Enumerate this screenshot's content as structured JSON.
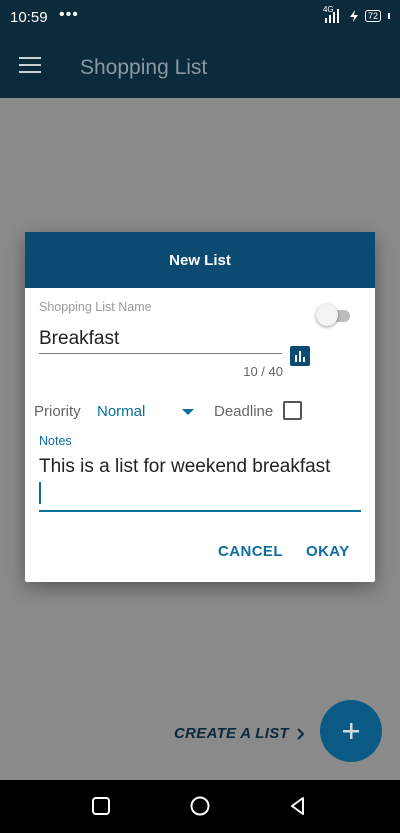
{
  "status_bar": {
    "time": "10:59",
    "dots": "•••",
    "network": "4G",
    "battery": "72"
  },
  "app_bar": {
    "title": "Shopping List"
  },
  "dialog": {
    "title": "New List",
    "name_label": "Shopping List Name",
    "name_value": "Breakfast",
    "char_count": "10 / 40",
    "priority_label": "Priority",
    "priority_value": "Normal",
    "deadline_label": "Deadline",
    "deadline_checked": false,
    "notes_label": "Notes",
    "notes_value": "This is a list for weekend breakfast",
    "cancel_label": "CANCEL",
    "okay_label": "OKAY",
    "toggle_on": false
  },
  "footer": {
    "create_list_label": "CREATE A LIST",
    "fab_icon": "plus-icon"
  },
  "colors": {
    "app_bar": "#0b2a3c",
    "dialog_header": "#0b4a73",
    "accent": "#0b6fa0",
    "fab": "#0b5a85"
  }
}
